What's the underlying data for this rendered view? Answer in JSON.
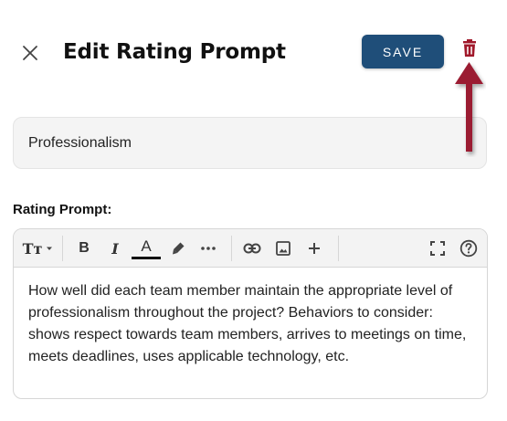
{
  "header": {
    "title": "Edit Rating Prompt",
    "save_label": "SAVE",
    "close_icon": "close-icon",
    "delete_icon": "trash-icon",
    "save_color": "#1f4e79",
    "delete_color": "#a0182a"
  },
  "form": {
    "name_value": "Professionalism",
    "prompt_label": "Rating Prompt:",
    "prompt_text": "How well did each team member maintain the appropriate level of professionalism throughout the project? Behaviors to consider: shows respect towards team members, arrives to meetings on time, meets deadlines, uses applicable technology, etc."
  },
  "toolbar": {
    "items": [
      "text-size-icon",
      "bold-icon",
      "italic-icon",
      "font-color-icon",
      "highlight-icon",
      "more-icon",
      "link-icon",
      "image-icon",
      "insert-icon",
      "fullscreen-icon",
      "help-icon"
    ],
    "bold_glyph": "B",
    "italic_glyph": "I",
    "color_glyph": "A",
    "text_size_glyph": "Tт"
  },
  "annotation": {
    "arrow_icon": "arrow-up-icon",
    "arrow_color": "#9b1b30"
  }
}
